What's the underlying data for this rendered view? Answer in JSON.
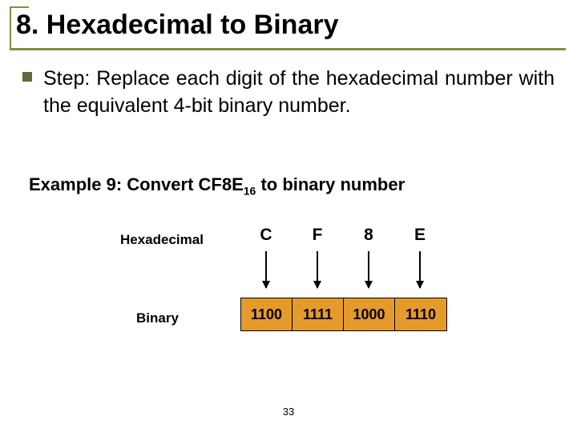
{
  "title": "8. Hexadecimal to Binary",
  "step": "Step: Replace each digit of the hexadecimal number with the equivalent 4-bit binary number.",
  "example": {
    "prefix": "Example 9: Convert CF8E",
    "subscript": "16",
    "suffix": " to binary number"
  },
  "labels": {
    "hex": "Hexadecimal",
    "binary": "Binary"
  },
  "hex_digits": [
    "C",
    "F",
    "8",
    "E"
  ],
  "bin_groups": [
    "1100",
    "1111",
    "1000",
    "1110"
  ],
  "page_number": "33",
  "chart_data": {
    "type": "table",
    "title": "Hexadecimal to 4-bit binary mapping for CF8E",
    "columns": [
      "Hexadecimal",
      "Binary"
    ],
    "rows": [
      {
        "Hexadecimal": "C",
        "Binary": "1100"
      },
      {
        "Hexadecimal": "F",
        "Binary": "1111"
      },
      {
        "Hexadecimal": "8",
        "Binary": "1000"
      },
      {
        "Hexadecimal": "E",
        "Binary": "1110"
      }
    ]
  }
}
